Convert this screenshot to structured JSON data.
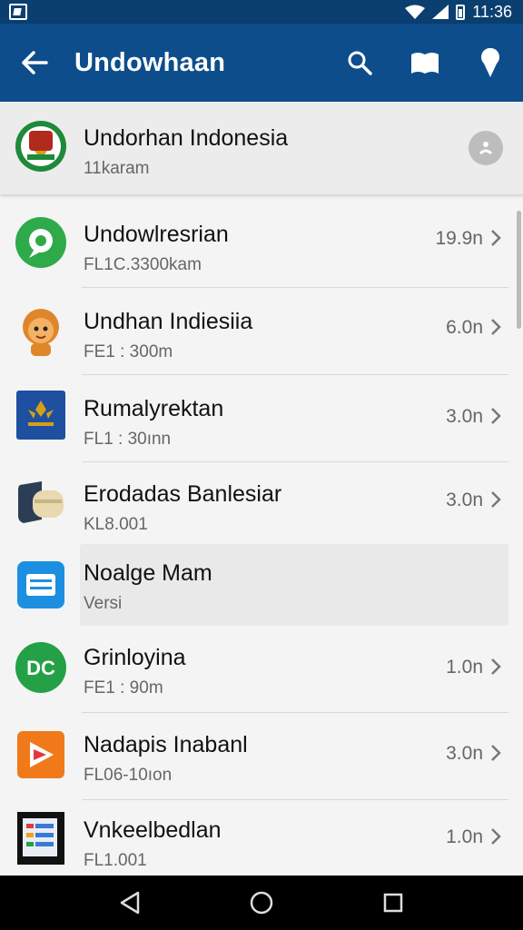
{
  "status_bar": {
    "time": "11:36"
  },
  "app_bar": {
    "title": "Undowhaan"
  },
  "list": {
    "pinned": {
      "title": "Undorhan Indonesia",
      "subtitle": "11karam"
    },
    "items": [
      {
        "title": "Undowlresrian",
        "subtitle": "FL1C.3300kam",
        "size": "19.9n"
      },
      {
        "title": "Undhan Indiesiia",
        "subtitle": "FE1 : 300m",
        "size": "6.0n"
      },
      {
        "title": "Rumalyrektan",
        "subtitle": "FL1 : 30ınn",
        "size": "3.0n"
      },
      {
        "title": "Erodadas Banlesiar",
        "subtitle": "KL8.001",
        "size": "3.0n"
      },
      {
        "title": "Noalge Mam",
        "subtitle": "Versi",
        "size": ""
      },
      {
        "title": "Grinloyina",
        "subtitle": "FE1 : 90m",
        "size": "1.0n"
      },
      {
        "title": "Nadapis Inabanl",
        "subtitle": "FL06-10ıon",
        "size": "3.0n"
      },
      {
        "title": "Vnkeelbedlan",
        "subtitle": "FL1.001",
        "size": "1.0n"
      }
    ]
  },
  "icons": {
    "back": "back-arrow-icon",
    "search": "search-icon",
    "map": "map-icon",
    "location": "location-pin-icon"
  },
  "colors": {
    "app_bar": "#0e4d8c",
    "status_bar": "#0b3f70"
  }
}
